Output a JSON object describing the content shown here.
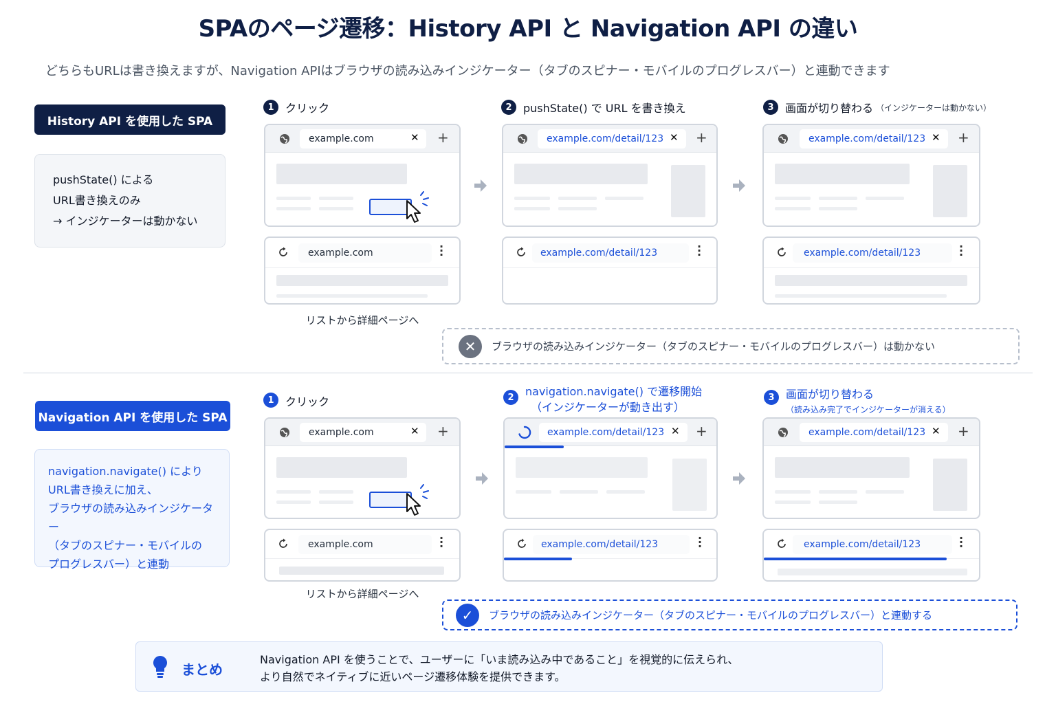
{
  "title": "SPAのページ遷移：History API と Navigation API の違い",
  "subtitle": "どちらもURLは書き換えますが、Navigation APIはブラウザの読み込みインジケーター（タブのスピナー・モバイルのプログレスバー）と連動できます",
  "history": {
    "badge": "History API を使用した SPA",
    "desc": [
      "pushState() による",
      "URL書き換えのみ",
      "→ インジケーターは動かない"
    ],
    "steps": [
      {
        "num": "1",
        "label": "クリック",
        "note": ""
      },
      {
        "num": "2",
        "label": "pushState() で URL を書き換え",
        "note": ""
      },
      {
        "num": "3",
        "label": "画面が切り替わる",
        "note": "（インジケーターは動かない）"
      }
    ],
    "urls": [
      "example.com",
      "example.com/detail/123",
      "example.com/detail/123"
    ],
    "mobile_urls": [
      "example.com",
      "example.com/detail/123",
      "example.com/detail/123"
    ],
    "caption": "リストから詳細ページへ",
    "result": "ブラウザの読み込みインジケーター（タブのスピナー・モバイルのプログレスバー）は動かない"
  },
  "navigation": {
    "badge": "Navigation API を使用した SPA",
    "desc": [
      "navigation.navigate() により",
      "URL書き換えに加え、",
      "ブラウザの読み込みインジケーター",
      "（タブのスピナー・モバイルの",
      "プログレスバー）と連動"
    ],
    "steps": [
      {
        "num": "1",
        "label": "クリック",
        "sub": ""
      },
      {
        "num": "2",
        "label": "navigation.navigate() で遷移開始",
        "sub": "（インジケーターが動き出す）"
      },
      {
        "num": "3",
        "label": "画面が切り替わる",
        "sub": "（読み込み完了でインジケーターが消える）"
      }
    ],
    "progress": {
      "desktop_step2": 0.28,
      "mobile_step2": 0.32,
      "mobile_step3": 0.85
    },
    "urls": [
      "example.com",
      "example.com/detail/123",
      "example.com/detail/123"
    ],
    "mobile_urls": [
      "example.com",
      "example.com/detail/123",
      "example.com/detail/123"
    ],
    "caption": "リストから詳細ページへ",
    "result": "ブラウザの読み込みインジケーター（タブのスピナー・モバイルのプログレスバー）と連動する"
  },
  "summary": {
    "label": "まとめ",
    "lines": [
      "Navigation API を使うことで、ユーザーに「いま読み込み中であること」を視覚的に伝えられ、",
      "より自然でネイティブに近いページ遷移体験を提供できます。"
    ]
  },
  "icons": {
    "globe": "globe-icon",
    "reload": "reload-icon",
    "spinner": "spinner-icon",
    "close": "close-icon",
    "plus": "plus-icon",
    "menu": "more-vert-icon",
    "cursor": "cursor-icon",
    "arrow": "arrow-right-icon",
    "x_circle": "x-circle-icon",
    "check_circle": "check-circle-icon",
    "bulb": "lightbulb-icon"
  },
  "colors": {
    "navy": "#0f1f45",
    "accent": "#1b4fd8",
    "gray": "#6b7280"
  }
}
